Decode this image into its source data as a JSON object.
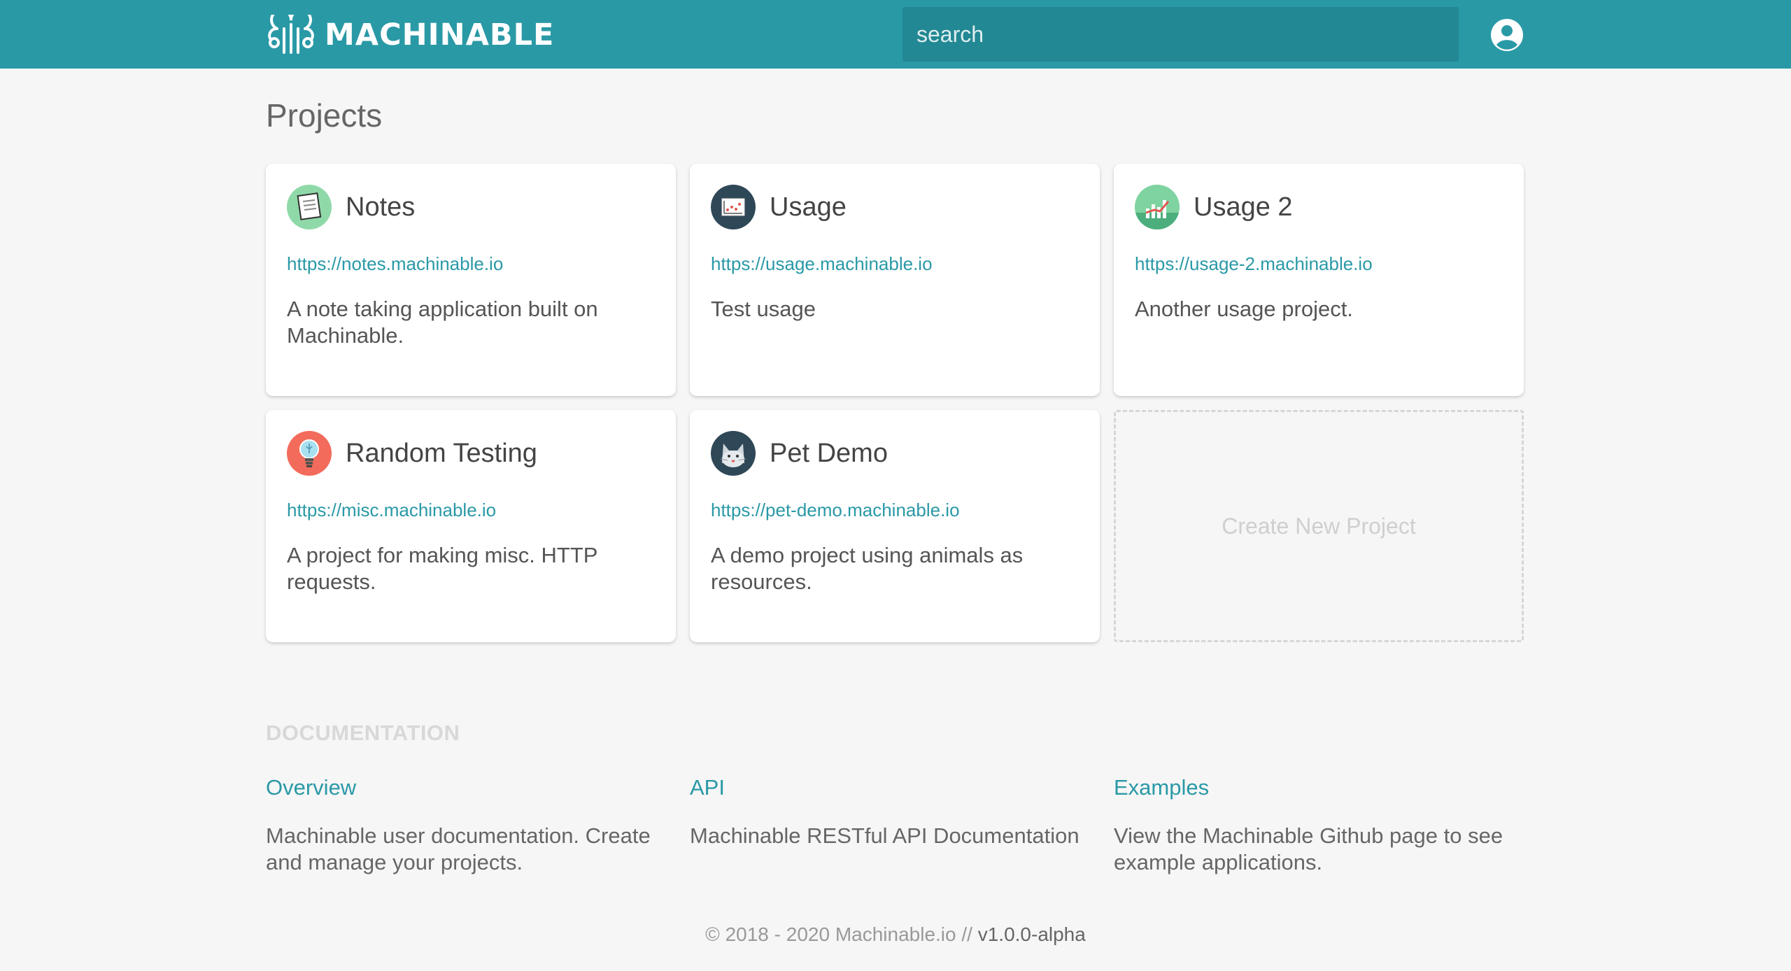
{
  "header": {
    "brand": "MACHINABLE",
    "search_placeholder": "search",
    "accent": "#2a99a6"
  },
  "page_title": "Projects",
  "projects": [
    {
      "title": "Notes",
      "url": "https://notes.machinable.io",
      "description": "A note taking application built on Machinable.",
      "icon": "notes-icon"
    },
    {
      "title": "Usage",
      "url": "https://usage.machinable.io",
      "description": "Test usage",
      "icon": "chart-icon"
    },
    {
      "title": "Usage 2",
      "url": "https://usage-2.machinable.io",
      "description": "Another usage project.",
      "icon": "bar-chart-icon"
    },
    {
      "title": "Random Testing",
      "url": "https://misc.machinable.io",
      "description": "A project for making misc. HTTP requests.",
      "icon": "lightbulb-icon"
    },
    {
      "title": "Pet Demo",
      "url": "https://pet-demo.machinable.io",
      "description": "A demo project using animals as resources.",
      "icon": "cat-icon"
    }
  ],
  "create_label": "Create New Project",
  "documentation": {
    "label": "DOCUMENTATION",
    "items": [
      {
        "title": "Overview",
        "description": "Machinable user documentation. Create and manage your projects."
      },
      {
        "title": "API",
        "description": "Machinable RESTful API Documentation"
      },
      {
        "title": "Examples",
        "description": "View the Machinable Github page to see example applications."
      }
    ]
  },
  "footer": {
    "copyright": "© 2018 - 2020 Machinable.io // ",
    "version": "v1.0.0-alpha"
  }
}
